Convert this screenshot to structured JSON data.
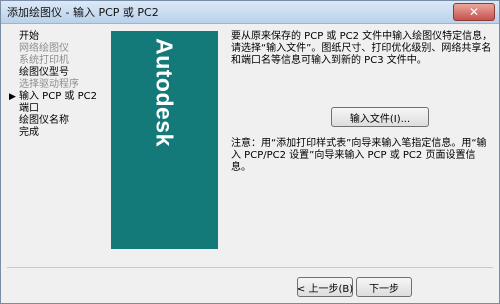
{
  "window": {
    "title": "添加绘图仪 - 输入 PCP 或 PC2",
    "close_glyph": "✕"
  },
  "steps": [
    {
      "label": "开始",
      "state": "normal"
    },
    {
      "label": "网络绘图仪",
      "state": "disabled"
    },
    {
      "label": "系统打印机",
      "state": "disabled"
    },
    {
      "label": "绘图仪型号",
      "state": "normal"
    },
    {
      "label": "选择驱动程序",
      "state": "disabled"
    },
    {
      "label": "输入 PCP 或 PC2",
      "state": "current"
    },
    {
      "label": "端口",
      "state": "normal"
    },
    {
      "label": "绘图仪名称",
      "state": "normal"
    },
    {
      "label": "完成",
      "state": "normal"
    }
  ],
  "brand": {
    "text": "Autodesk",
    "color": "#137a79"
  },
  "description": "要从原来保存的 PCP 或 PC2 文件中输入绘图仪特定信息，请选择“输入文件”。图纸尺寸、打印优化级别、网络共享名和端口名等信息可输入到新的 PC3 文件中。",
  "import_button": "输入文件(I)...",
  "note": "注意：用“添加打印样式表”向导来输入笔指定信息。用“输入 PCP/PC2 设置”向导来输入 PCP 或 PC2 页面设置信息。",
  "footer": {
    "back_label": "< 上一步(B)",
    "next_label": "下一步"
  }
}
